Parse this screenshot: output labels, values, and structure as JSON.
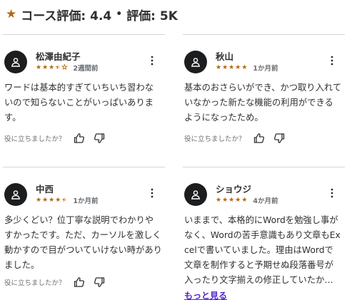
{
  "header": {
    "star_icon": "star-icon",
    "course_rating": "コース評価: 4.4",
    "separator": "•",
    "rating_count": "評価: 5K"
  },
  "colors": {
    "star": "#b4690e",
    "link": "#5624d0",
    "text": "#2d2f31",
    "muted": "#6a6f73",
    "divider": "#d1d7dc"
  },
  "reviews": [
    {
      "name": "松澤由紀子",
      "rating": 3.5,
      "date": "2週間前",
      "text": "ワードは基本的すぎていちいち習わないので知らないことがいっぱいあります。",
      "helpful_question": "役に立ちましたか？"
    },
    {
      "name": "秋山",
      "rating": 5,
      "date": "1か月前",
      "text": "基本のおさらいができ、かつ取り入れていなかった新たな機能の利用ができるようになったため。",
      "helpful_question": "役に立ちましたか？"
    },
    {
      "name": "中西",
      "rating": 4.5,
      "date": "1か月前",
      "text": "多少くどい？位丁寧な説明でわかりやすかったです。ただ、カーソルを激しく動かすので目がついていけない時がありました。",
      "helpful_question": "役に立ちましたか？"
    },
    {
      "name": "ショウジ",
      "rating": 5,
      "date": "4か月前",
      "text": "いままで、本格的にWordを勉強し事がなく、Wordの苦手意識もあり文章もExcelで書いていました。理由はWordで文章を制作すると予期せぬ段落番号が入ったり文字揃えの修正していたか…",
      "more_label": "もっと見る"
    }
  ]
}
